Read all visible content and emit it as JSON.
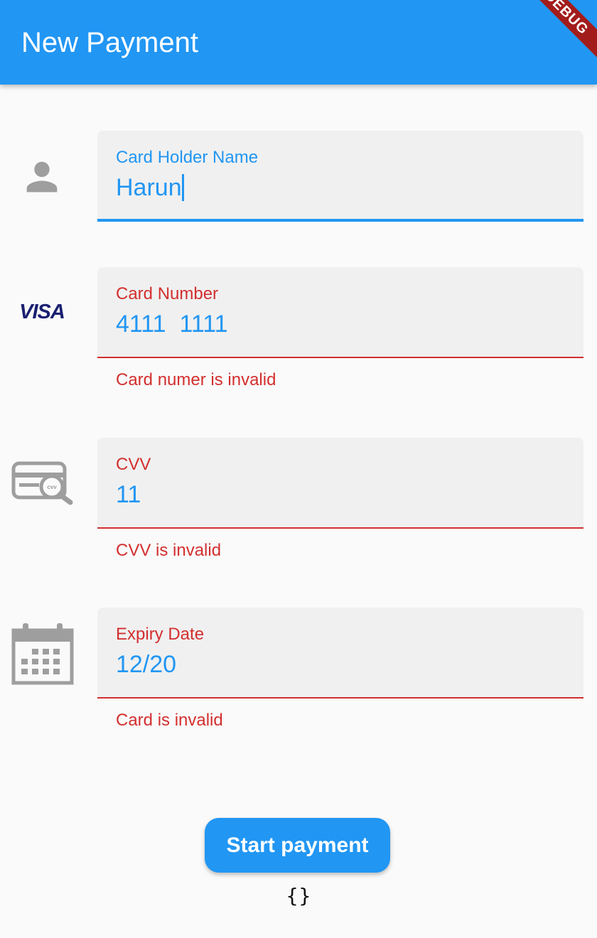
{
  "appbar": {
    "title": "New Payment",
    "debug_banner": "DEBUG",
    "color": "#2196f3"
  },
  "fields": {
    "holder": {
      "label": "Card Holder Name",
      "value": "Harun",
      "icon": "person-icon"
    },
    "number": {
      "label": "Card Number",
      "value": "4111  1111",
      "error": "Card numer is invalid",
      "icon": "visa-icon",
      "brand_text": "VISA"
    },
    "cvv": {
      "label": "CVV",
      "value": "11",
      "error": "CVV is invalid",
      "icon": "cvv-card-icon",
      "icon_text": "cvv"
    },
    "expiry": {
      "label": "Expiry Date",
      "value": "12/20",
      "error": "Card is invalid",
      "icon": "calendar-icon"
    }
  },
  "actions": {
    "start_payment_label": "Start payment"
  },
  "result": {
    "text": "{}"
  },
  "colors": {
    "accent": "#2196f3",
    "error": "#d32f2f",
    "field_bg": "#f0f0f0",
    "icon_gray": "#9e9e9e"
  }
}
